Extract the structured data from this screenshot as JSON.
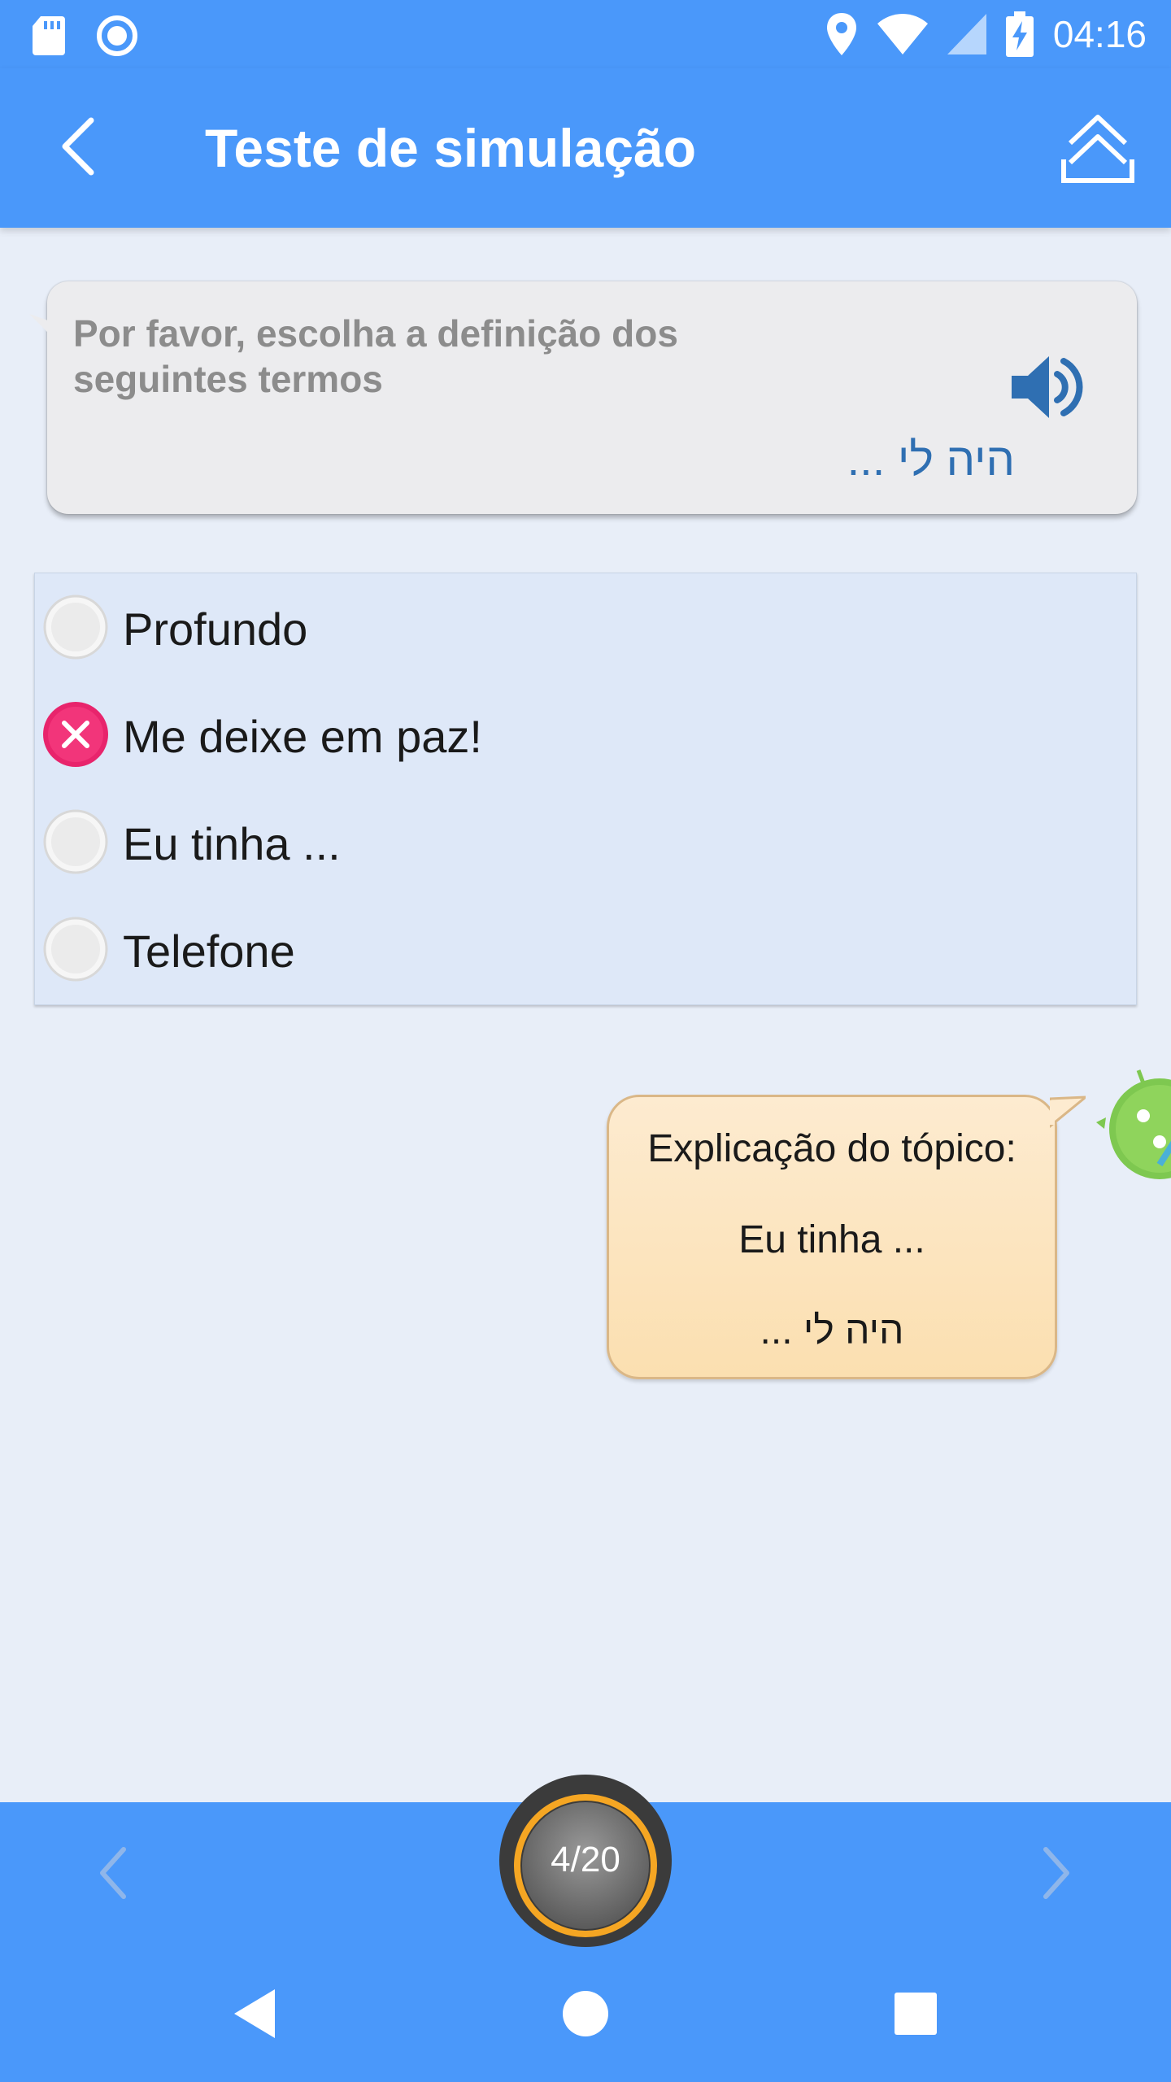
{
  "status_bar": {
    "time": "04:16",
    "left_icons": [
      "sd-card-icon",
      "sync-circle-icon"
    ],
    "right_icons": [
      "location-pin-icon",
      "wifi-icon",
      "cell-signal-icon",
      "battery-charging-icon"
    ]
  },
  "app_bar": {
    "title": "Teste de simulação",
    "back_icon": "chevron-left-icon",
    "share_icon": "upload-double-chevron-icon"
  },
  "question": {
    "prompt": "Por favor, escolha a definição dos seguintes termos",
    "term": "היה לי ...",
    "speaker_icon": "speaker-icon"
  },
  "options": [
    {
      "label": "Profundo",
      "state": "unselected"
    },
    {
      "label": "Me deixe em paz!",
      "state": "wrong"
    },
    {
      "label": "Eu tinha ...",
      "state": "unselected"
    },
    {
      "label": "Telefone",
      "state": "unselected"
    }
  ],
  "explanation": {
    "heading": "Explicação do tópico:",
    "translation": "Eu tinha ...",
    "term": "היה לי ..."
  },
  "bottom_bar": {
    "progress": "4/20",
    "prev_icon": "chevron-left-icon",
    "next_icon": "chevron-right-icon"
  },
  "colors": {
    "primary": "#4a98fa",
    "background": "#e8eef8",
    "wrong": "#e8246c",
    "term": "#2f6fb2",
    "bubble": "#fbe4bf",
    "progress_ring": "#f5a623"
  }
}
